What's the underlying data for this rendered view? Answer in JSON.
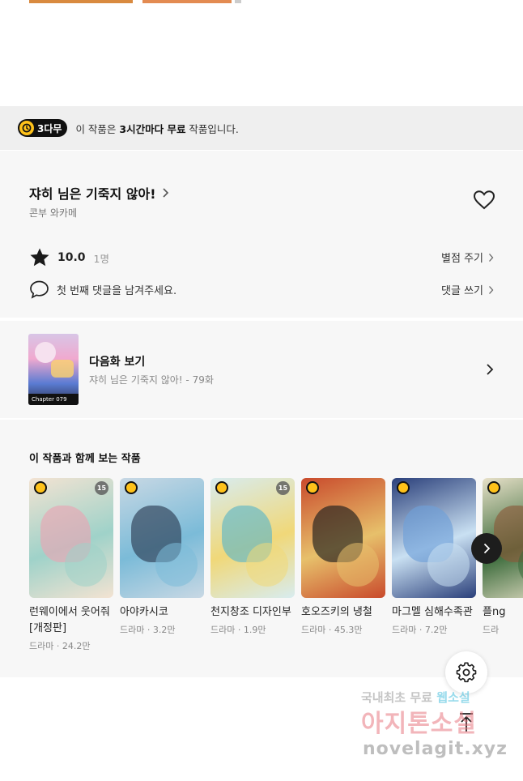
{
  "banner": {
    "badge": "3다무",
    "text_prefix": "이 작품은 ",
    "text_bold": "3시간마다 무료",
    "text_suffix": " 작품입니다."
  },
  "work": {
    "title": "쟈히 님은 기죽지 않아!",
    "author": "콘부 와카메",
    "rating": "10.0",
    "rating_count": "1명",
    "rate_link": "별점 주기",
    "comment_prompt": "첫 번째 댓글을 남겨주세요.",
    "comment_link": "댓글 쓰기"
  },
  "next_episode": {
    "title": "다음화 보기",
    "subtitle": "쟈히 님은 기죽지 않아! - 79화",
    "thumb_caption": "Chapter 079"
  },
  "recommendations": {
    "title": "이 작품과 함께 보는 작품",
    "items": [
      {
        "name": "런웨이에서 웃어줘 [개정판]",
        "genre": "드라마",
        "views": "24.2만",
        "age": "15",
        "c1": "#f3e3d2",
        "c2": "#e8a6b4",
        "c3": "#9fd2c9"
      },
      {
        "name": "아야카시코",
        "genre": "드라마",
        "views": "3.2만",
        "age": "",
        "c1": "#c8d8e4",
        "c2": "#2c3d55",
        "c3": "#7bbbd8"
      },
      {
        "name": "천지창조 디자인부",
        "genre": "드라마",
        "views": "1.9만",
        "age": "15",
        "c1": "#d8ecef",
        "c2": "#5fb7c6",
        "c3": "#f0d879"
      },
      {
        "name": "호오즈키의 냉철",
        "genre": "드라마",
        "views": "45.3만",
        "age": "",
        "c1": "#c94a2c",
        "c2": "#1d1d1d",
        "c3": "#e7c06b"
      },
      {
        "name": "마그멜 심해수족관",
        "genre": "드라마",
        "views": "7.2만",
        "age": "",
        "c1": "#2a3f7a",
        "c2": "#6fa0d8",
        "c3": "#c9e0f2"
      },
      {
        "name": "플ng",
        "genre": "드라",
        "views": "",
        "age": "",
        "c1": "#e7e0c8",
        "c2": "#8a5a3a",
        "c3": "#3a6a3a"
      }
    ]
  },
  "watermark": {
    "line1_a": "국내최초 무료",
    "line1_b": "웹소설",
    "line2": "아지톤소설",
    "line3": "novelagit.xyz"
  },
  "icons": [
    "clock-icon",
    "chevron-right-icon",
    "heart-icon",
    "star-icon",
    "speech-bubble-icon",
    "gear-icon",
    "arrow-up-icon"
  ]
}
